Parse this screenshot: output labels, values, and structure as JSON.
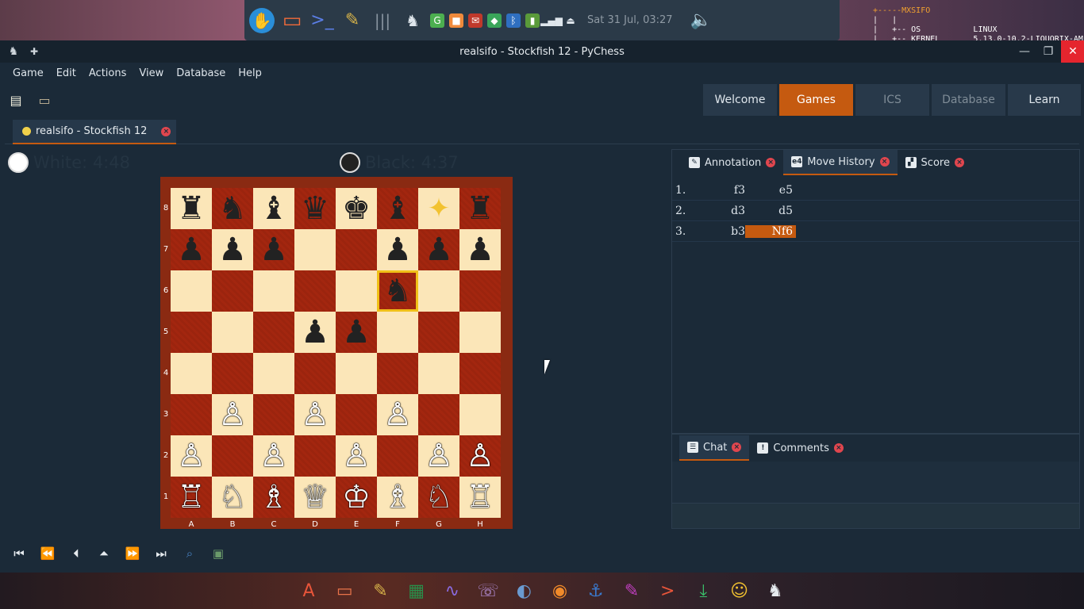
{
  "desktop": {
    "clock": "Sat 31 Jul, 03:27",
    "sysinfo_lines": [
      "+-----MXSIFO",
      "|   |",
      "|   +-- OS           LINUX",
      "|   +-- KERNEL       5.13.0-10.2-LIQUORIX-AM"
    ],
    "top_dock_icons": [
      "app-launcher-icon",
      "folder-icon",
      "terminal-icon",
      "text-editor-icon",
      "separator-icon",
      "chess-icon",
      "grammarly-icon",
      "package-icon",
      "mail-icon",
      "redshift-icon",
      "bluetooth-icon",
      "battery-icon",
      "wifi-icon",
      "eject-icon",
      "volume-icon"
    ],
    "bottom_dock_icons": [
      "font-icon",
      "folder-icon",
      "pen-icon",
      "terminal-icon",
      "chart-icon",
      "phone-icon",
      "disks-icon",
      "firefox-icon",
      "anchor-icon",
      "text-editor-icon",
      "terminal-icon",
      "download-icon",
      "manager-icon",
      "chess-icon"
    ]
  },
  "window": {
    "title": "realsifo - Stockfish 12 - PyChess",
    "controls": {
      "minimize": "—",
      "maximize": "❐",
      "close": "✕"
    }
  },
  "menubar": [
    "Game",
    "Edit",
    "Actions",
    "View",
    "Database",
    "Help"
  ],
  "perspectives": [
    {
      "label": "Welcome",
      "state": "normal"
    },
    {
      "label": "Games",
      "state": "active"
    },
    {
      "label": "ICS",
      "state": "dim"
    },
    {
      "label": "Database",
      "state": "dim"
    },
    {
      "label": "Learn",
      "state": "normal"
    }
  ],
  "game_tab": {
    "label": "realsifo - Stockfish 12"
  },
  "clocks": {
    "white": "White: 4:48",
    "black": "Black: 4:37"
  },
  "board": {
    "files": [
      "A",
      "B",
      "C",
      "D",
      "E",
      "F",
      "G",
      "H"
    ],
    "ranks": [
      "8",
      "7",
      "6",
      "5",
      "4",
      "3",
      "2",
      "1"
    ],
    "rows": [
      [
        "♜",
        "♞",
        "♝",
        "♛",
        "♚",
        "♝",
        "✦",
        "♜"
      ],
      [
        "♟",
        "♟",
        "♟",
        "",
        "",
        "♟",
        "♟",
        "♟"
      ],
      [
        "",
        "",
        "",
        "",
        "",
        "♞",
        "",
        ""
      ],
      [
        "",
        "",
        "",
        "♟",
        "♟",
        "",
        "",
        ""
      ],
      [
        "",
        "",
        "",
        "",
        "",
        "",
        "",
        ""
      ],
      [
        "",
        "♙",
        "",
        "♙",
        "",
        "♙",
        "",
        ""
      ],
      [
        "♙",
        "",
        "♙",
        "",
        "♙",
        "",
        "♙",
        "♙"
      ],
      [
        "♖",
        "♘",
        "♗",
        "♕",
        "♔",
        "♗",
        "♘",
        "♖"
      ]
    ],
    "colors": [
      [
        "b",
        "b",
        "b",
        "b",
        "b",
        "b",
        "s",
        "b"
      ],
      [
        "b",
        "b",
        "b",
        "",
        "",
        "b",
        "b",
        "b"
      ],
      [
        "",
        "",
        "",
        "",
        "",
        "b",
        "",
        ""
      ],
      [
        "",
        "",
        "",
        "b",
        "b",
        "",
        "",
        ""
      ],
      [
        "",
        "",
        "",
        "",
        "",
        "",
        "",
        ""
      ],
      [
        "",
        "w",
        "",
        "w",
        "",
        "w",
        "",
        ""
      ],
      [
        "w",
        "",
        "w",
        "",
        "w",
        "",
        "w",
        "w"
      ],
      [
        "w",
        "w",
        "w",
        "w",
        "w",
        "w",
        "w",
        "w"
      ]
    ],
    "highlight": "f6",
    "accent_colors": {
      "dark_square": "#a3260f",
      "light_square": "#fbe6b8",
      "highlight": "#f0c018"
    }
  },
  "side_tabs": [
    {
      "label": "Annotation",
      "icon": "pencil-icon"
    },
    {
      "label": "Move History",
      "icon": "e4-icon"
    },
    {
      "label": "Score",
      "icon": "chart-icon"
    }
  ],
  "moves": [
    {
      "num": "1.",
      "white": "f3",
      "black": "e5"
    },
    {
      "num": "2.",
      "white": "d3",
      "black": "d5"
    },
    {
      "num": "3.",
      "white": "b3",
      "black": "Nf6"
    }
  ],
  "bottom_tabs": [
    {
      "label": "Chat",
      "icon": "chat-icon"
    },
    {
      "label": "Comments",
      "icon": "exclamation-icon"
    }
  ],
  "nav_buttons": [
    "first-move-icon",
    "back-icon",
    "prev-main-icon",
    "up-icon",
    "forward-icon",
    "last-move-icon",
    "zoom-icon",
    "save-icon"
  ],
  "accent": "#c55a10"
}
